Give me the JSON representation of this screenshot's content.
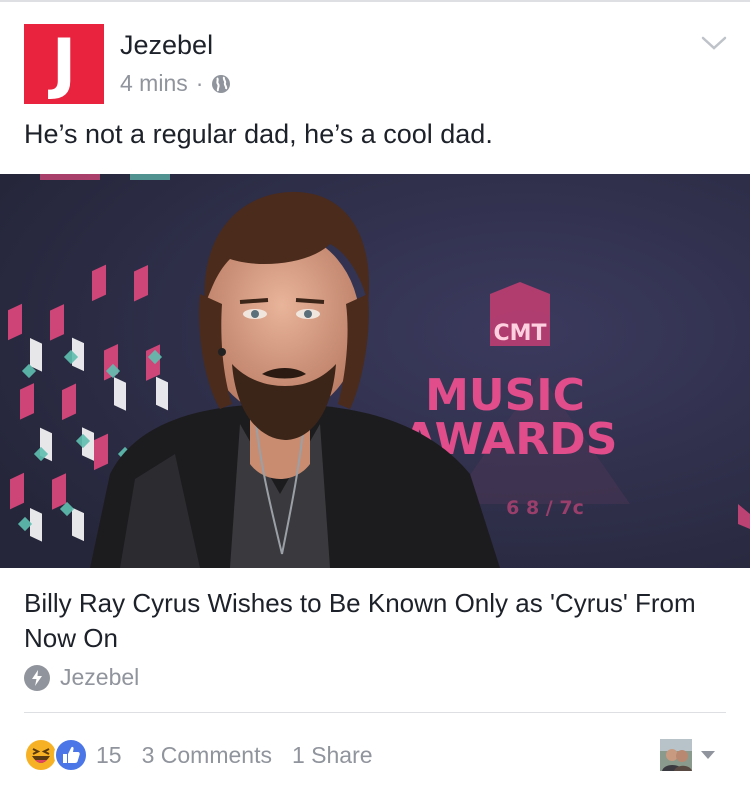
{
  "post": {
    "page_name": "Jezebel",
    "avatar_letter": "J",
    "timestamp": "4 mins",
    "separator": "·",
    "status_text": "He’s not a regular dad, he’s a cool dad."
  },
  "link": {
    "photo_sign_logo": "CMT",
    "photo_sign_line1": "MUSIC",
    "photo_sign_line2": "AWARDS",
    "photo_sign_date": "6 8 / 7c",
    "title": "Billy Ray Cyrus Wishes to Be Known Only as 'Cyrus' From Now On",
    "source": "Jezebel"
  },
  "footer": {
    "reaction_count": "15",
    "comments": "3 Comments",
    "shares": "1 Share"
  },
  "icons": {
    "audience": "globe-icon",
    "options": "chevron-down-icon",
    "source": "instant-article-bolt-icon",
    "reactions": [
      "haha-reaction-icon",
      "like-reaction-icon"
    ],
    "viewer": "viewer-avatar",
    "viewer_menu": "caret-down-icon"
  },
  "colors": {
    "brand": "#e9233d",
    "meta_text": "#90949c",
    "like_blue": "#4a76e8",
    "haha_yellow": "#f7b125",
    "backdrop": "#2e2e48",
    "backdrop_pink": "#e0487e"
  }
}
